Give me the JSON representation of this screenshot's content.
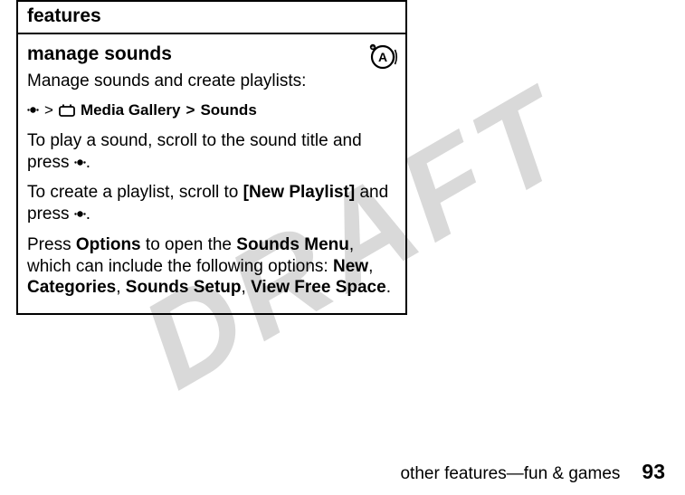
{
  "watermark": "DRAFT",
  "table": {
    "header": "features",
    "section_title": "manage sounds",
    "intro": "Manage sounds and create playlists:",
    "nav": {
      "gt1": ">",
      "media_gallery": "Media Gallery",
      "gt2": ">",
      "sounds": "Sounds"
    },
    "play_text_a": "To play a sound, scroll to the sound title and press ",
    "play_text_b": ".",
    "playlist_a": "To create a playlist, scroll to ",
    "playlist_new": "[New Playlist]",
    "playlist_b": " and press ",
    "playlist_c": ".",
    "options_a": "Press ",
    "options_label": "Options",
    "options_b": " to open the ",
    "sounds_menu": "Sounds Menu",
    "options_c": ", which can include the following options: ",
    "opt_new": "New",
    "comma1": ", ",
    "opt_categories": "Categories",
    "comma2": ", ",
    "opt_setup": "Sounds Setup",
    "comma3": ", ",
    "opt_free": "View Free Space",
    "period": "."
  },
  "footer": {
    "section": "other features—fun & games",
    "page": "93"
  }
}
